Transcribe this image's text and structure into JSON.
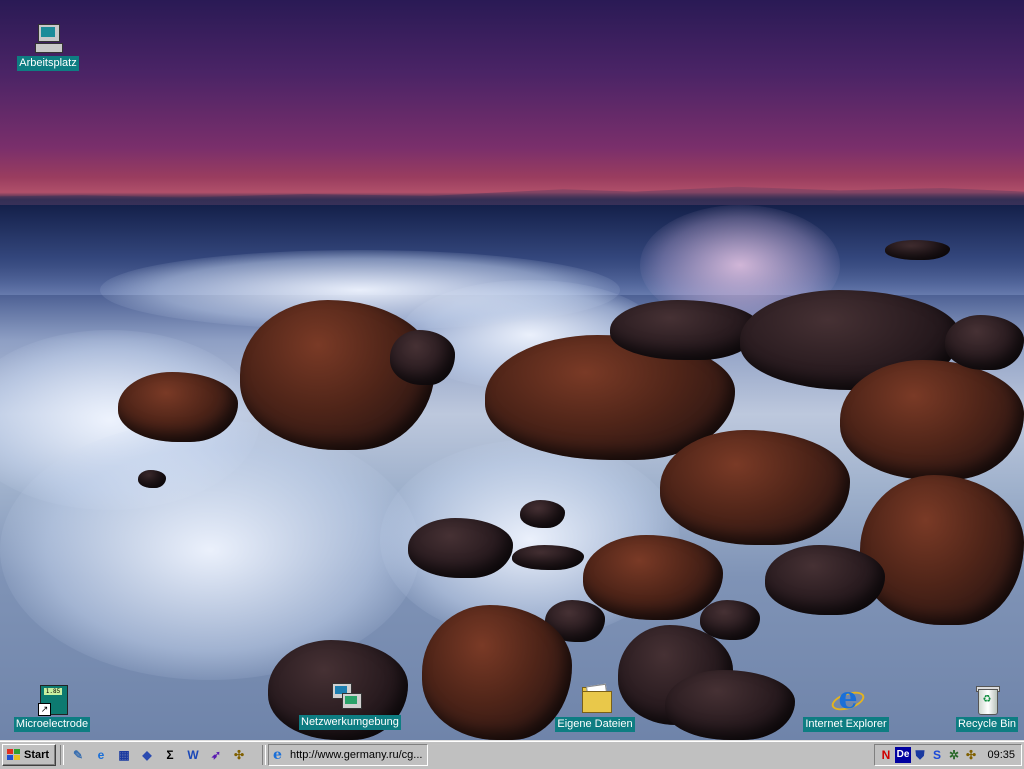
{
  "desktop": {
    "icons": [
      {
        "id": "arbeitsplatz",
        "label": "Arbeitsplatz",
        "icon": "my-computer-icon"
      },
      {
        "id": "microelectrode",
        "label": "Microelectrode",
        "icon": "microelectrode-app-icon",
        "lcd_text": "1.85"
      },
      {
        "id": "netzwerk",
        "label": "Netzwerkumgebung",
        "icon": "network-neighborhood-icon"
      },
      {
        "id": "eigene",
        "label": "Eigene Dateien",
        "icon": "my-documents-folder-icon"
      },
      {
        "id": "ie",
        "label": "Internet Explorer",
        "icon": "internet-explorer-icon"
      },
      {
        "id": "recycle",
        "label": "Recycle Bin",
        "icon": "recycle-bin-icon"
      }
    ]
  },
  "taskbar": {
    "start_label": "Start",
    "quick_launch": [
      {
        "name": "show-desktop-icon",
        "glyph": "✎",
        "color": "#3a6fb0"
      },
      {
        "name": "internet-explorer-quicklaunch-icon",
        "glyph": "e",
        "color": "#1a6fd8"
      },
      {
        "name": "grid-app-icon",
        "glyph": "▦",
        "color": "#1a3aa0"
      },
      {
        "name": "diamond-app-icon",
        "glyph": "◆",
        "color": "#2a4ab0"
      },
      {
        "name": "sigma-app-icon",
        "glyph": "Σ",
        "color": "#000000"
      },
      {
        "name": "word-icon",
        "glyph": "W",
        "color": "#1a48b8"
      },
      {
        "name": "arrow-app-icon",
        "glyph": "➶",
        "color": "#5a1ab0"
      },
      {
        "name": "puzzle-app-icon",
        "glyph": "✣",
        "color": "#806000"
      }
    ],
    "tasks": [
      {
        "label": "http://www.germany.ru/cg..."
      }
    ],
    "tray": {
      "icons": [
        {
          "name": "norton-icon",
          "glyph": "N",
          "color": "#d00000"
        },
        {
          "name": "language-de-icon",
          "glyph": "De",
          "color": "#ffffff",
          "bg": "#0000a0"
        },
        {
          "name": "shield-icon",
          "glyph": "⛊",
          "color": "#1a3aa0"
        },
        {
          "name": "s-app-icon",
          "glyph": "S",
          "color": "#1a48d8"
        },
        {
          "name": "gear-tray-icon",
          "glyph": "✲",
          "color": "#2a6a2a"
        },
        {
          "name": "puzzle-tray-icon",
          "glyph": "✣",
          "color": "#806000"
        }
      ],
      "clock": "09:35"
    }
  }
}
